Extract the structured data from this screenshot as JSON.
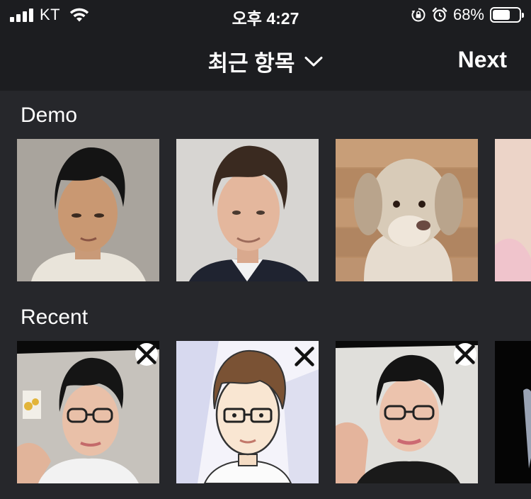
{
  "status_bar": {
    "carrier": "KT",
    "time": "오후 4:27",
    "battery_text": "68%",
    "battery_level": 0.68,
    "icons": [
      "signal-icon",
      "wifi-icon",
      "orientation-lock-icon",
      "alarm-icon",
      "battery-icon"
    ]
  },
  "nav": {
    "title": "최근 항목",
    "next_label": "Next",
    "dropdown_icon": "chevron-down-icon"
  },
  "sections": {
    "demo": {
      "title": "Demo",
      "items": [
        "demo-photo-man-1",
        "demo-photo-man-2",
        "demo-photo-dog",
        "demo-photo-partial"
      ]
    },
    "recent": {
      "title": "Recent",
      "items": [
        "recent-photo-selfie",
        "recent-photo-cartoon",
        "recent-photo-selfie-2",
        "recent-photo-partial"
      ]
    }
  },
  "colors": {
    "background": "#1c1d20",
    "content_background": "#26272b",
    "text": "#ffffff"
  }
}
